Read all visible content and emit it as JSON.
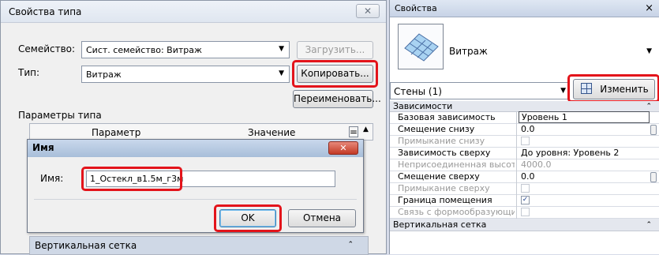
{
  "type_properties": {
    "title": "Свойства типа",
    "close": "✕",
    "family_label": "Семейство:",
    "family_value": "Сист. семейство: Витраж",
    "load_button": "Загрузить...",
    "type_label": "Тип:",
    "type_value": "Витраж",
    "duplicate_button": "Копировать...",
    "rename_button": "Переименовать...",
    "params_label": "Параметры типа",
    "col_param": "Параметр",
    "col_value": "Значение",
    "col_eq": "=",
    "partial_row": "Вертикальная сетка"
  },
  "name_dialog": {
    "title": "Имя",
    "close": "✕",
    "name_label": "Имя:",
    "name_value": "1_Остекл_в1.5м_г3м",
    "ok_button": "OK",
    "cancel_button": "Отмена"
  },
  "properties": {
    "title": "Свойства",
    "close": "×",
    "type_name": "Витраж",
    "filter": "Стены (1)",
    "edit_type_button": "Изменить тип",
    "groups": [
      {
        "name": "Зависимости",
        "rows": [
          {
            "name": "Базовая зависимость",
            "value": "Уровень 1",
            "state": "editing"
          },
          {
            "name": "Смещение снизу",
            "value": "0.0",
            "state": "normal",
            "scroll": true
          },
          {
            "name": "Примыкание снизу",
            "value": "",
            "state": "disabled",
            "checkbox": "off"
          },
          {
            "name": "Зависимость сверху",
            "value": "До уровня: Уровень 2",
            "state": "normal"
          },
          {
            "name": "Неприсоединенная высота",
            "value": "4000.0",
            "state": "disabled"
          },
          {
            "name": "Смещение сверху",
            "value": "0.0",
            "state": "normal",
            "scroll": true
          },
          {
            "name": "Примыкание сверху",
            "value": "",
            "state": "disabled",
            "checkbox": "off"
          },
          {
            "name": "Граница помещения",
            "value": "",
            "state": "normal",
            "checkbox": "on"
          },
          {
            "name": "Связь с формообразующи...",
            "value": "",
            "state": "disabled",
            "checkbox": "off"
          }
        ]
      },
      {
        "name": "Вертикальная сетка",
        "rows": []
      }
    ]
  },
  "colors": {
    "highlight": "#e3141b",
    "titlebar": "#c7d3e6"
  },
  "icons": [
    "close-icon",
    "dropdown-arrow-icon",
    "curtain-wall-thumbnail",
    "edit-type-icon",
    "collapse-chevron-icon",
    "checkbox-icon"
  ]
}
